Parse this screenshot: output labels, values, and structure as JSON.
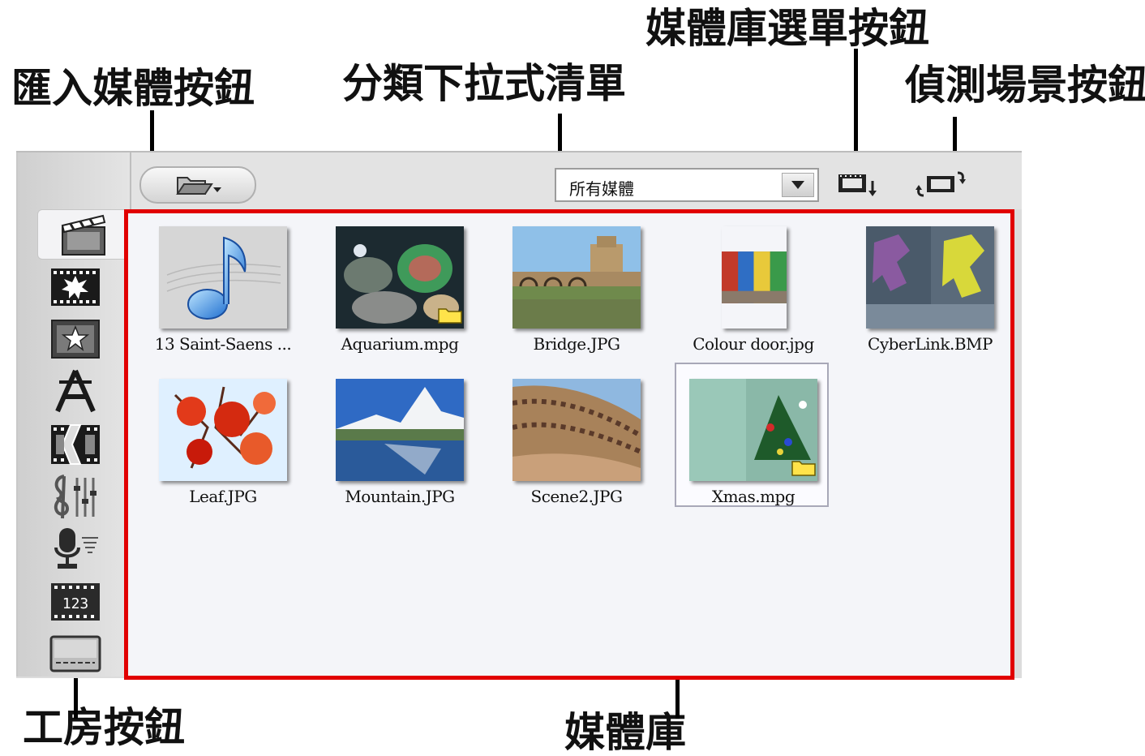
{
  "annotations": {
    "import_media_button": "匯入媒體按鈕",
    "category_dropdown": "分類下拉式清單",
    "library_menu_button": "媒體庫選單按鈕",
    "detect_scene_button": "偵測場景按鈕",
    "room_buttons": "工房按鈕",
    "media_library": "媒體庫"
  },
  "toolbar": {
    "category_selected": "所有媒體"
  },
  "media": [
    {
      "name": "13 Saint-Saens ...",
      "kind": "audio"
    },
    {
      "name": "Aquarium.mpg",
      "kind": "video"
    },
    {
      "name": "Bridge.JPG",
      "kind": "image"
    },
    {
      "name": "Colour door.jpg",
      "kind": "image"
    },
    {
      "name": "CyberLink.BMP",
      "kind": "image"
    },
    {
      "name": "Leaf.JPG",
      "kind": "image"
    },
    {
      "name": "Mountain.JPG",
      "kind": "image"
    },
    {
      "name": "Scene2.JPG",
      "kind": "image"
    },
    {
      "name": "Xmas.mpg",
      "kind": "video",
      "selected": true
    }
  ],
  "sidebar_rooms": [
    {
      "icon": "clapperboard-icon",
      "active": true
    },
    {
      "icon": "burst-effect-icon"
    },
    {
      "icon": "star-overlay-icon"
    },
    {
      "icon": "title-letter-icon"
    },
    {
      "icon": "transition-icon"
    },
    {
      "icon": "audio-mixer-icon"
    },
    {
      "icon": "microphone-icon"
    },
    {
      "icon": "chapter-icon",
      "label": "123"
    },
    {
      "icon": "subtitle-icon"
    }
  ],
  "colors": {
    "highlight_frame": "#e10000",
    "library_bg": "#f4f5f9"
  }
}
